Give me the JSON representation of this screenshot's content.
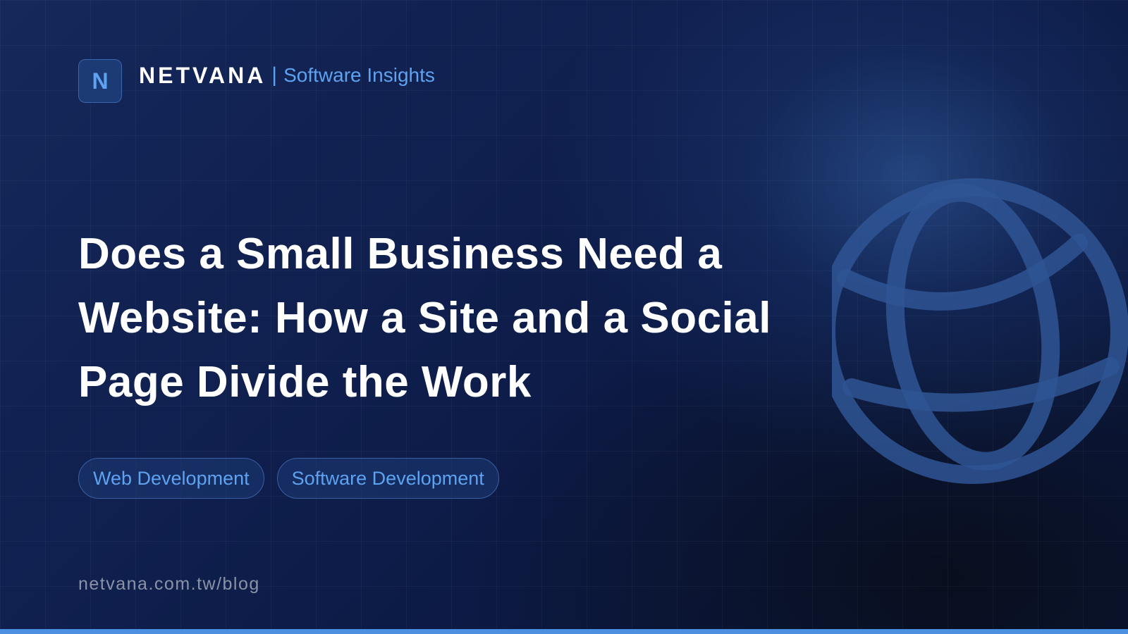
{
  "brand": {
    "logo_letter": "N",
    "name": "NETVANA",
    "separator": "|",
    "subtitle": "Software Insights"
  },
  "title": "Does a Small Business Need a Website: How a Site and a Social Page Divide the Work",
  "tags": [
    "Web Development",
    "Software Development"
  ],
  "url": "netvana.com.tw/blog",
  "decorations": {
    "globe": "globe-icon"
  },
  "colors": {
    "accent": "#5ea2f0",
    "background": "#0f1c43",
    "bottom_bar": "#4b8fe0"
  }
}
